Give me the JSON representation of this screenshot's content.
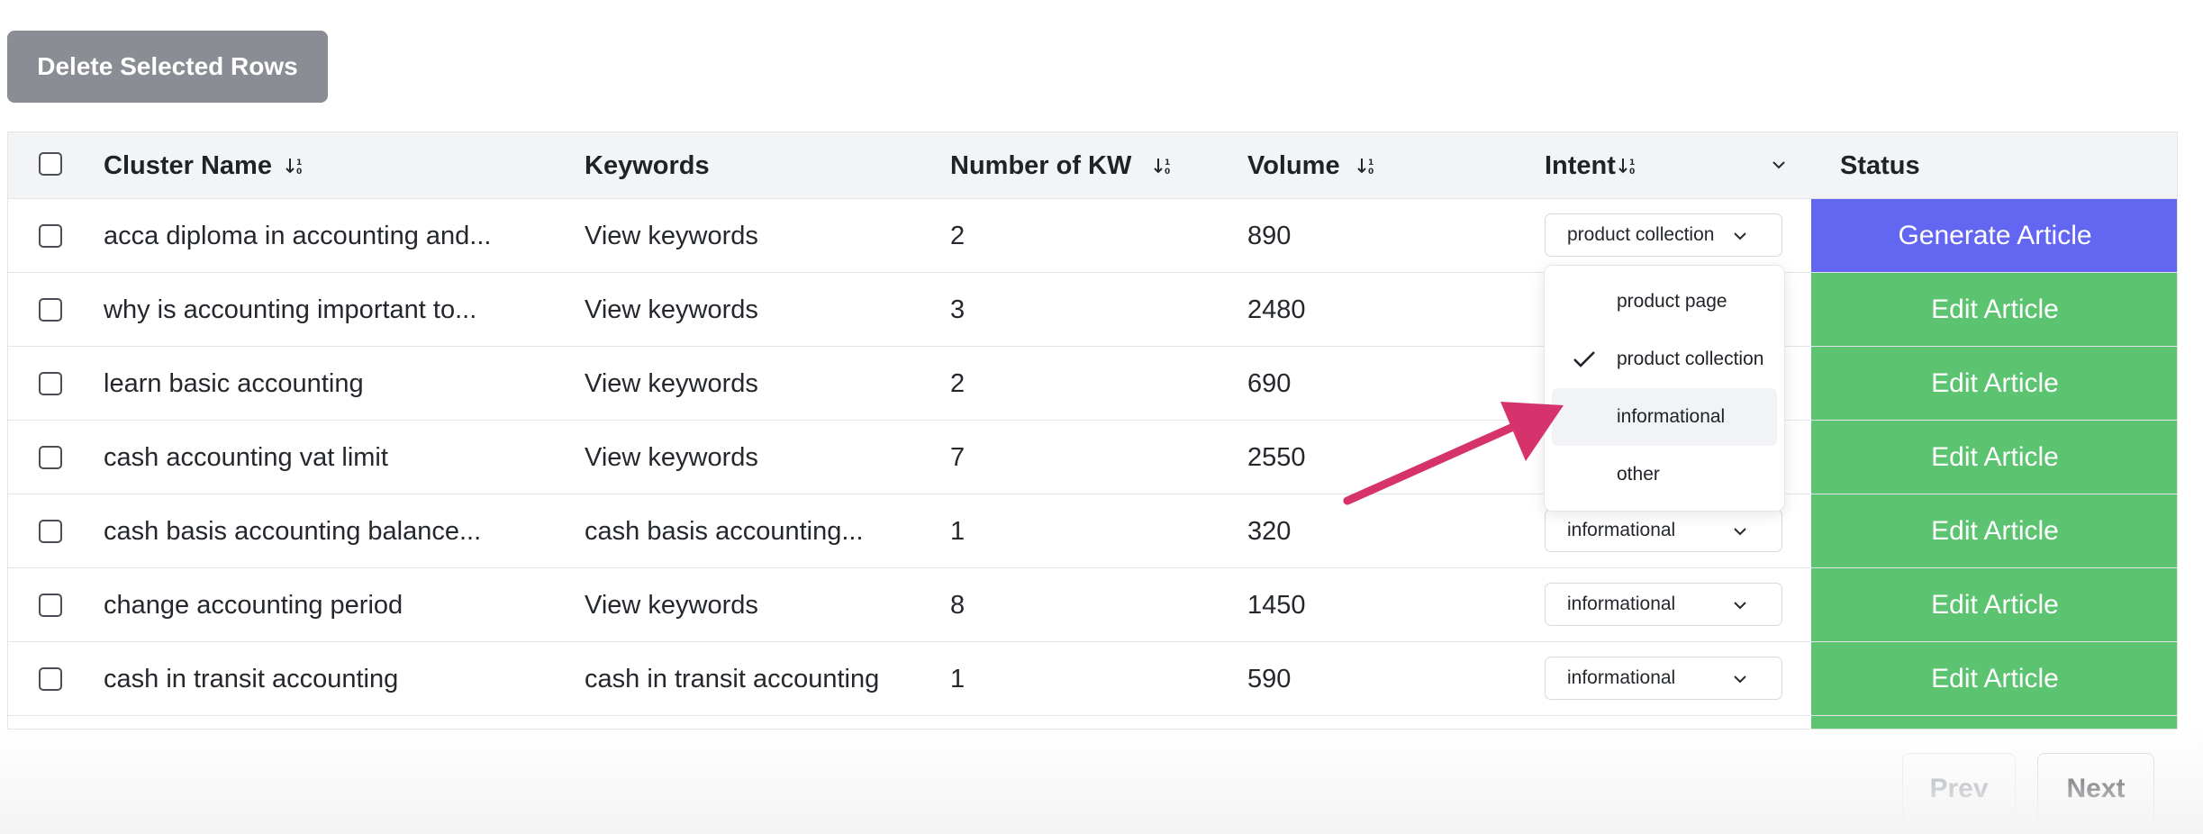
{
  "toolbar": {
    "delete_label": "Delete Selected Rows"
  },
  "table": {
    "headers": {
      "cluster": "Cluster Name",
      "keywords": "Keywords",
      "num_kw": "Number of KW",
      "volume": "Volume",
      "intent": "Intent",
      "status": "Status"
    },
    "rows": [
      {
        "cluster": "acca diploma in accounting and...",
        "keywords": "View keywords",
        "num_kw": "2",
        "volume": "890",
        "intent": "product collection",
        "status": "Generate Article"
      },
      {
        "cluster": "why is accounting important to...",
        "keywords": "View keywords",
        "num_kw": "3",
        "volume": "2480",
        "intent": "",
        "status": "Edit Article"
      },
      {
        "cluster": "learn basic accounting",
        "keywords": "View keywords",
        "num_kw": "2",
        "volume": "690",
        "intent": "",
        "status": "Edit Article"
      },
      {
        "cluster": "cash accounting vat limit",
        "keywords": "View keywords",
        "num_kw": "7",
        "volume": "2550",
        "intent": "",
        "status": "Edit Article"
      },
      {
        "cluster": "cash basis accounting balance...",
        "keywords": "cash basis accounting...",
        "num_kw": "1",
        "volume": "320",
        "intent": "informational",
        "status": "Edit Article"
      },
      {
        "cluster": "change accounting period",
        "keywords": "View keywords",
        "num_kw": "8",
        "volume": "1450",
        "intent": "informational",
        "status": "Edit Article"
      },
      {
        "cluster": "cash in transit accounting",
        "keywords": "cash in transit accounting",
        "num_kw": "1",
        "volume": "590",
        "intent": "informational",
        "status": "Edit Article"
      }
    ]
  },
  "dropdown": {
    "options": [
      "product page",
      "product collection",
      "informational",
      "other"
    ],
    "selected": "product collection",
    "hovered": "informational"
  },
  "pagination": {
    "prev": "Prev",
    "next": "Next"
  },
  "colors": {
    "generate": "#6366f1",
    "edit": "#5cc470",
    "delete_button": "#8a8d93",
    "arrow": "#d6336c",
    "header_bg": "#f3f4f6"
  }
}
